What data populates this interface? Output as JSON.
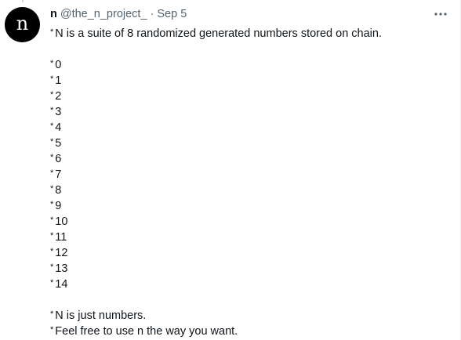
{
  "author": {
    "avatar_letter": "n",
    "display_name": "n",
    "handle": "@the_n_project_",
    "separator": "·",
    "timestamp": "Sep 5"
  },
  "more_icon": "more-horizontal-icon",
  "tweet": {
    "intro": "N is a suite of 8 randomized generated numbers stored on chain.",
    "items": [
      "0",
      "1",
      "2",
      "3",
      "4",
      "5",
      "6",
      "7",
      "8",
      "9",
      "10",
      "11",
      "12",
      "13",
      "14"
    ],
    "outro": [
      "N is just numbers.",
      "Feel free to use n the way you want."
    ],
    "bullet": "*"
  },
  "colors": {
    "text_primary": "#0f1419",
    "text_secondary": "#536471",
    "avatar_bg": "#000000",
    "avatar_fg": "#ffffff"
  }
}
